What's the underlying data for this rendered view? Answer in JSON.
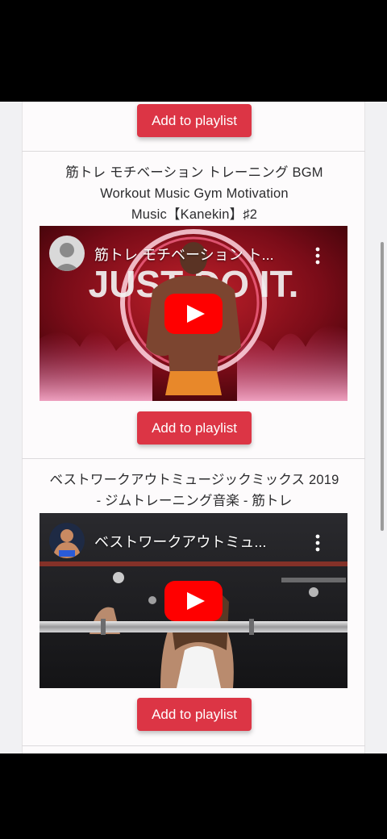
{
  "items": [
    {
      "button_label": "Add to playlist"
    },
    {
      "title_lines": [
        "筋トレ モチベーション トレーニング BGM",
        "Workout Music Gym Motivation",
        "Music【Kanekin】♯2"
      ],
      "video_overlay_title": "筋トレ モチベーション ト...",
      "thumbnail_text": "JUST DO IT.",
      "button_label": "Add to playlist"
    },
    {
      "title_lines": [
        "ベストワークアウトミュージックミックス 2019",
        "- ジムトレーニング音楽 - 筋トレ"
      ],
      "video_overlay_title": "ベストワークアウトミュ...",
      "button_label": "Add to playlist"
    }
  ],
  "colors": {
    "button": "#dc3545",
    "play_button": "#ff0000"
  }
}
